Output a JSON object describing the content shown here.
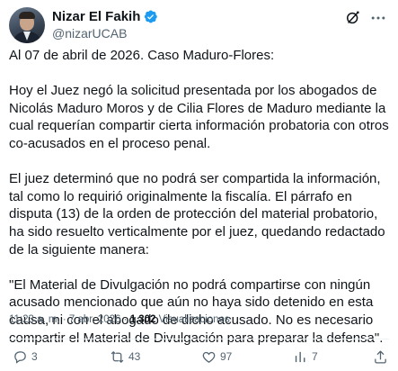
{
  "author": {
    "display_name": "Nizar El Fakih",
    "handle": "@nizarUCAB",
    "verified": true
  },
  "tweet": {
    "paragraphs": [
      "Al 07 de abril de 2026. Caso Maduro-Flores:",
      "Hoy el Juez negó la solicitud presentada por los abogados de Nicolás Maduro Moros y de Cilia Flores de Maduro mediante la cual requerían compartir cierta información probatoria con otros co-acusados en el proceso penal.",
      "El juez determinó que no podrá ser compartida la información, tal como lo requirió originalmente la fiscalía. El párrafo en disputa (13) de la orden de protección del material probatorio, ha sido resuelto verticalmente por el juez, quedando redactado de la siguiente manera:",
      "\"El Material de Divulgación no podrá compartirse con ningún acusado mencionado que aún no haya sido detenido en esta causa, ni con el abogado de dicho acusado. No es necesario compartir el Material de Divulgación para preparar la defensa\"."
    ]
  },
  "meta": {
    "timestamp": "11:23 a. m. · 7 abr. 2026 ·",
    "views_count": "1.302",
    "views_label": "Visualizaciones"
  },
  "actions": {
    "replies": "3",
    "retweets": "43",
    "likes": "97",
    "views": "7"
  },
  "icons": {
    "verified": "verified-badge-icon",
    "grok": "grok-icon",
    "more": "more-options-icon",
    "reply": "reply-icon",
    "retweet": "retweet-icon",
    "like": "heart-icon",
    "views": "views-bar-chart-icon",
    "share": "share-icon"
  },
  "colors": {
    "verified": "#1d9bf0",
    "text": "#0f1419",
    "secondary": "#536471"
  }
}
